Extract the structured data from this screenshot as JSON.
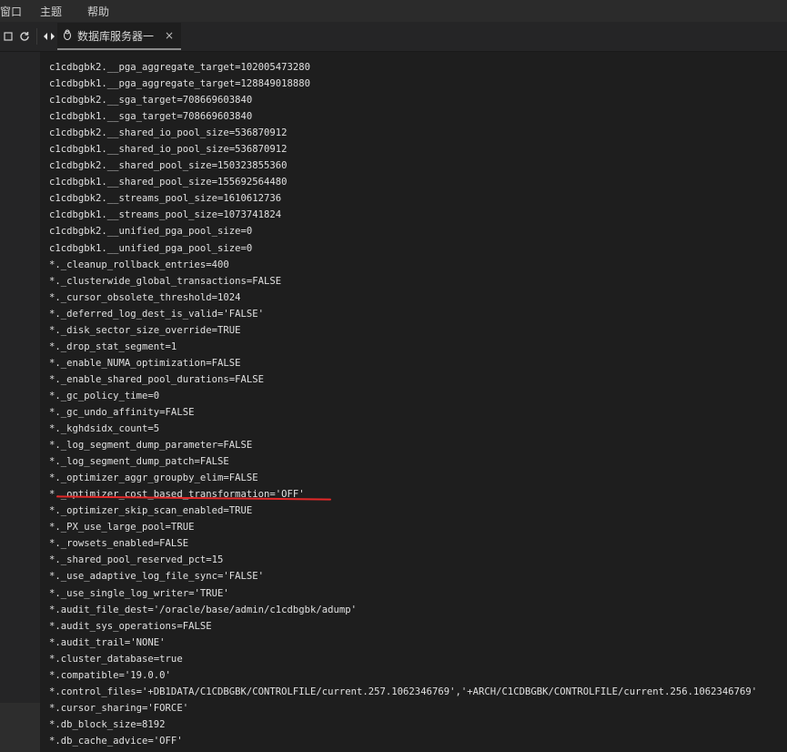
{
  "menubar": {
    "items": [
      "窗口",
      "主题",
      "帮助"
    ]
  },
  "toolbar": {
    "icons": [
      "square-icon",
      "refresh-icon",
      "nav-arrows-icon"
    ]
  },
  "tab": {
    "title": "数据库服务器一",
    "close": "×"
  },
  "colors": {
    "background": "#1e1e1e",
    "text": "#e0e0e0",
    "annotation": "#e32828"
  },
  "lines": [
    "c1cdbgbk2.__pga_aggregate_target=102005473280",
    "c1cdbgbk1.__pga_aggregate_target=128849018880",
    "c1cdbgbk2.__sga_target=708669603840",
    "c1cdbgbk1.__sga_target=708669603840",
    "c1cdbgbk2.__shared_io_pool_size=536870912",
    "c1cdbgbk1.__shared_io_pool_size=536870912",
    "c1cdbgbk2.__shared_pool_size=150323855360",
    "c1cdbgbk1.__shared_pool_size=155692564480",
    "c1cdbgbk2.__streams_pool_size=1610612736",
    "c1cdbgbk1.__streams_pool_size=1073741824",
    "c1cdbgbk2.__unified_pga_pool_size=0",
    "c1cdbgbk1.__unified_pga_pool_size=0",
    "*._cleanup_rollback_entries=400",
    "*._clusterwide_global_transactions=FALSE",
    "*._cursor_obsolete_threshold=1024",
    "*._deferred_log_dest_is_valid='FALSE'",
    "*._disk_sector_size_override=TRUE",
    "*._drop_stat_segment=1",
    "*._enable_NUMA_optimization=FALSE",
    "*._enable_shared_pool_durations=FALSE",
    "*._gc_policy_time=0",
    "*._gc_undo_affinity=FALSE",
    "*._kghdsidx_count=5",
    "*._log_segment_dump_parameter=FALSE",
    "*._log_segment_dump_patch=FALSE",
    "*._optimizer_aggr_groupby_elim=FALSE",
    "*._optimizer_cost_based_transformation='OFF'",
    "*._optimizer_skip_scan_enabled=TRUE",
    "*._PX_use_large_pool=TRUE",
    "*._rowsets_enabled=FALSE",
    "*._shared_pool_reserved_pct=15",
    "*._use_adaptive_log_file_sync='FALSE'",
    "*._use_single_log_writer='TRUE'",
    "*.audit_file_dest='/oracle/base/admin/c1cdbgbk/adump'",
    "*.audit_sys_operations=FALSE",
    "*.audit_trail='NONE'",
    "*.cluster_database=true",
    "*.compatible='19.0.0'",
    "*.control_files='+DB1DATA/C1CDBGBK/CONTROLFILE/current.257.1062346769','+ARCH/C1CDBGBK/CONTROLFILE/current.256.1062346769'",
    "*.cursor_sharing='FORCE'",
    "*.db_block_size=8192",
    "*.db_cache_advice='OFF'"
  ]
}
